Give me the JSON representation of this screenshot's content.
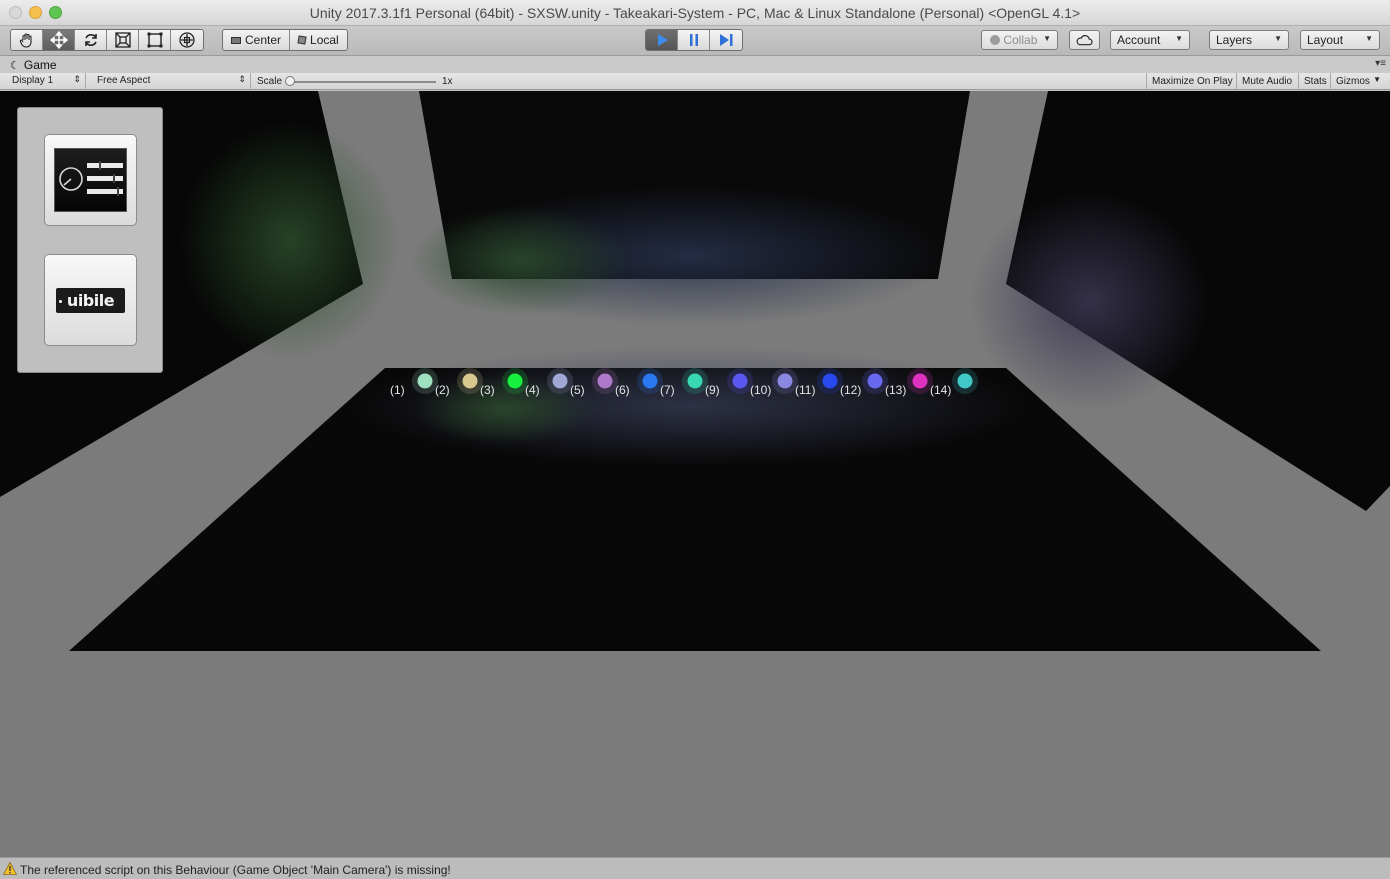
{
  "window": {
    "title": "Unity 2017.3.1f1 Personal (64bit) - SXSW.unity - Takeakari-System - PC, Mac & Linux Standalone (Personal) <OpenGL 4.1>"
  },
  "toolbar": {
    "tools": [
      "hand-tool-icon",
      "move-tool-icon",
      "rotate-tool-icon",
      "scale-tool-icon",
      "rect-tool-icon",
      "transform-tool-icon"
    ],
    "pivot_center": "Center",
    "pivot_local": "Local",
    "collab_label": "Collab",
    "account_label": "Account",
    "layers_label": "Layers",
    "layout_label": "Layout",
    "play_color": "#3b8cf0"
  },
  "game_view": {
    "tab_label": "Game",
    "display": "Display 1",
    "aspect": "Free Aspect",
    "scale_label": "Scale",
    "scale_value": "1x",
    "buttons": {
      "maximize": "Maximize On Play",
      "mute": "Mute Audio",
      "stats": "Stats",
      "gizmos": "Gizmos"
    }
  },
  "scene": {
    "leds": [
      {
        "label": "(1)",
        "color": "#9fe0c0"
      },
      {
        "label": "(2)",
        "color": "#d8c890"
      },
      {
        "label": "(3)",
        "color": "#18f040"
      },
      {
        "label": "(4)",
        "color": "#a0a8d8"
      },
      {
        "label": "(5)",
        "color": "#b078c8"
      },
      {
        "label": "(6)",
        "color": "#2a78f0"
      },
      {
        "label": "(7)",
        "color": "#38d8b0"
      },
      {
        "label": "(9)",
        "color": "#5a58f0"
      },
      {
        "label": "(10)",
        "color": "#8a88e0"
      },
      {
        "label": "(11)",
        "color": "#2848f0"
      },
      {
        "label": "(12)",
        "color": "#6868f0"
      },
      {
        "label": "(13)",
        "color": "#e030c0"
      },
      {
        "label": "(14)",
        "color": "#40c8c8"
      }
    ],
    "wibile_logo_text": "uibile"
  },
  "status": {
    "message": "The referenced script on this Behaviour (Game Object 'Main Camera') is missing!"
  }
}
